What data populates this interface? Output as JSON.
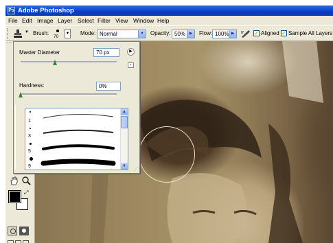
{
  "window": {
    "title": "Adobe Photoshop"
  },
  "menu": [
    "File",
    "Edit",
    "Image",
    "Layer",
    "Select",
    "Filter",
    "View",
    "Window",
    "Help"
  ],
  "options": {
    "brush_label": "Brush:",
    "brush_size": "70",
    "mode_label": "Mode:",
    "mode_value": "Normal",
    "opacity_label": "Opacity:",
    "opacity_value": "50%",
    "flow_label": "Flow:",
    "flow_value": "100%",
    "aligned_label": "Aligned",
    "aligned_checked": true,
    "sample_all_label": "Sample All Layers",
    "sample_all_checked": true
  },
  "brush_panel": {
    "diameter_label": "Master Diameter",
    "diameter_value": "70 px",
    "diameter_fraction": 0.36,
    "hardness_label": "Hardness:",
    "hardness_value": "0%",
    "hardness_fraction": 0.0,
    "presets": [
      {
        "number": "1"
      },
      {
        "number": "3"
      },
      {
        "number": "5"
      },
      {
        "number": "9"
      }
    ]
  },
  "colors": {
    "title_bar": "#0a3fc4",
    "chrome": "#ece9d8",
    "foreground": "#000000",
    "background": "#ffffff"
  }
}
